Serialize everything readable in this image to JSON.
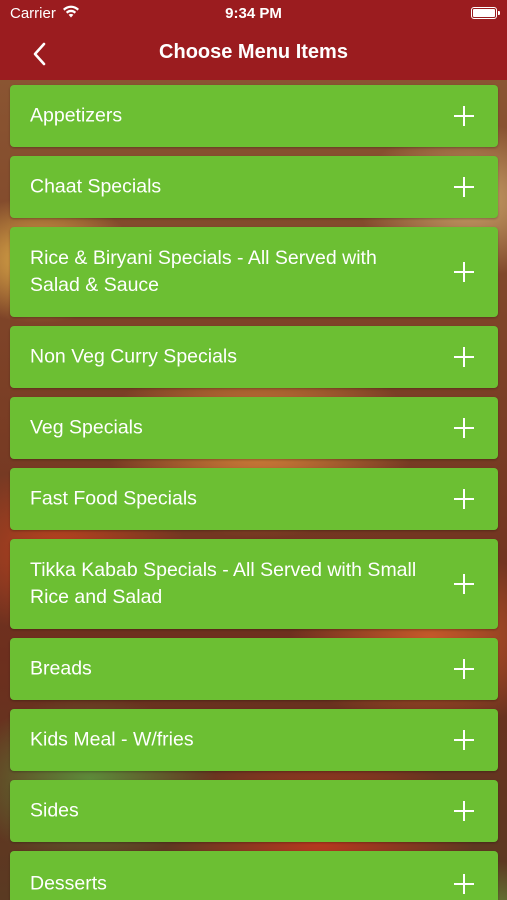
{
  "status_bar": {
    "carrier": "Carrier",
    "time": "9:34 PM",
    "wifi_icon": "wifi-icon",
    "battery_icon": "battery-icon"
  },
  "nav": {
    "title": "Choose Menu Items",
    "back_icon": "chevron-left-icon"
  },
  "colors": {
    "nav_background": "#9b1c1f",
    "item_background": "#6cbf33",
    "text": "#ffffff"
  },
  "menu": {
    "expand_icon": "plus-icon",
    "items": [
      {
        "label": "Appetizers"
      },
      {
        "label": "Chaat Specials"
      },
      {
        "label": "Rice & Biryani Specials - All Served with Salad & Sauce"
      },
      {
        "label": "Non Veg Curry Specials"
      },
      {
        "label": "Veg Specials"
      },
      {
        "label": "Fast Food Specials"
      },
      {
        "label": "Tikka Kabab Specials - All Served with Small Rice and Salad"
      },
      {
        "label": "Breads"
      },
      {
        "label": "Kids Meal - W/fries"
      },
      {
        "label": "Sides"
      },
      {
        "label": "Desserts"
      }
    ]
  }
}
